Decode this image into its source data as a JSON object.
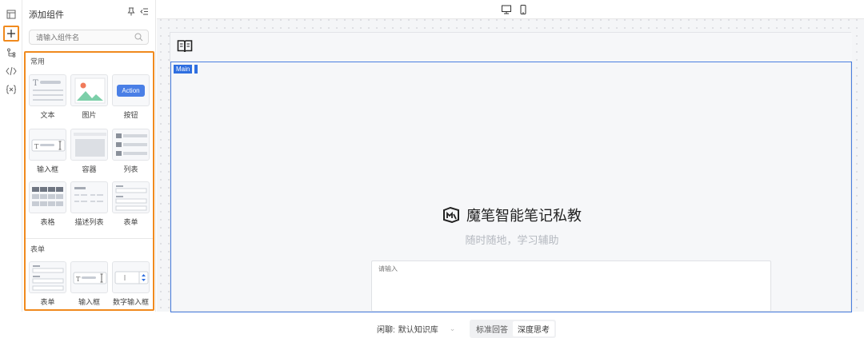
{
  "panel": {
    "title": "添加组件",
    "search_placeholder": "请输入组件名",
    "sections": [
      {
        "title": "常用",
        "items": [
          "文本",
          "图片",
          "按钮",
          "输入框",
          "容器",
          "列表",
          "表格",
          "描述列表",
          "表单"
        ]
      },
      {
        "title": "表单",
        "items": [
          "表单",
          "输入框",
          "数字输入框"
        ]
      }
    ],
    "action_label": "Action"
  },
  "canvas": {
    "main_tag": "Main",
    "brand_title": "魔笔智能笔记私教",
    "subtitle": "随时随地，学习辅助",
    "input_placeholder": "请输入",
    "kb_prefix": "闲聊:",
    "kb_value": "默认知识库",
    "modes": [
      "标准回答",
      "深度思考"
    ],
    "active_mode": "深度思考"
  },
  "colors": {
    "highlight": "#f08a1e",
    "accent": "#2f6fe0",
    "action_button": "#4a7fe6"
  }
}
